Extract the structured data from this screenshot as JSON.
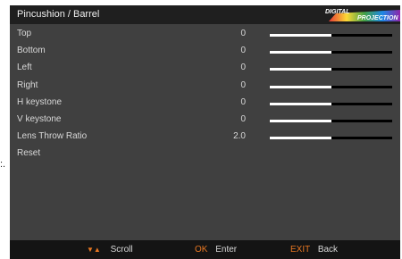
{
  "menu": {
    "title": "Pincushion / Barrel",
    "logo_top": "DIGITAL",
    "logo_bottom": "PROJECTION",
    "items": [
      {
        "label": "Top",
        "value": "0",
        "slider_fraction": 0.5
      },
      {
        "label": "Bottom",
        "value": "0",
        "slider_fraction": 0.5
      },
      {
        "label": "Left",
        "value": "0",
        "slider_fraction": 0.5
      },
      {
        "label": "Right",
        "value": "0",
        "slider_fraction": 0.5
      },
      {
        "label": "H keystone",
        "value": "0",
        "slider_fraction": 0.5
      },
      {
        "label": "V keystone",
        "value": "0",
        "slider_fraction": 0.5
      },
      {
        "label": "Lens Throw Ratio",
        "value": "2.0",
        "slider_fraction": 0.5
      },
      {
        "label": "Reset"
      }
    ]
  },
  "footer": {
    "scroll_icon": "▼▲",
    "scroll_label": "Scroll",
    "ok_key": "OK",
    "ok_label": "Enter",
    "exit_key": "EXIT",
    "exit_label": "Back"
  },
  "side_fragment": ":.",
  "colors": {
    "background": "#404040",
    "title_bar": "#1f1f1f",
    "footer_bar": "#141414",
    "accent": "#e87722",
    "text": "#d8d8d8",
    "slider_fill": "#ffffff",
    "slider_track": "#000000"
  }
}
